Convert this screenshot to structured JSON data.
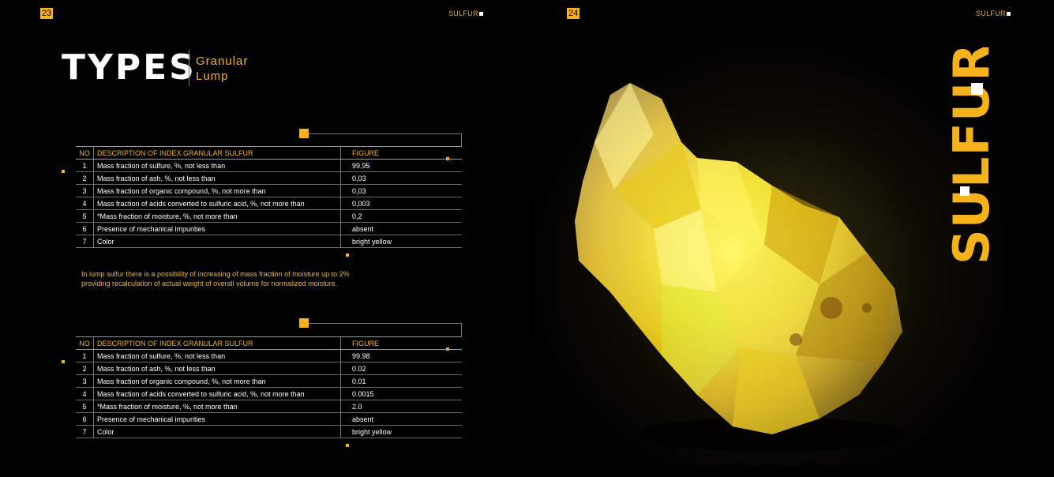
{
  "left_page": {
    "page_number": "23",
    "running_head": "SULFUR",
    "title": "TYPES",
    "subtypes": [
      "Granular",
      "Lump"
    ],
    "table1": {
      "headers": [
        "NO",
        "DESCRIPTION OF INDEX GRANULAR SULFUR",
        "FIGURE"
      ],
      "rows": [
        [
          "1",
          "Mass fraction of sulfure, %, not less than",
          "99,95"
        ],
        [
          "2",
          "Mass fraction of ash, %, not less than",
          "0,03"
        ],
        [
          "3",
          "Mass fraction of organic compound, %, not more than",
          "0,03"
        ],
        [
          "4",
          "Mass fraction of acids converted to sulfuric acid, %, not more than",
          "0,003"
        ],
        [
          "5",
          "*Mass fraction of moisture, %, not more than",
          "0,2"
        ],
        [
          "6",
          "Presence of mechanical impurities",
          "absent"
        ],
        [
          "7",
          "Color",
          "bright yellow"
        ]
      ]
    },
    "note_lines": [
      "In lump sulfur there is a possibility of increasing of mass fraction of moisture up to 2%",
      "providing recalculation of actual weight of overall volume for normalized moisture."
    ],
    "table2": {
      "headers": [
        "NO",
        "DESCRIPTION OF INDEX GRANULAR SULFUR",
        "FIGURE"
      ],
      "rows": [
        [
          "1",
          "Mass fraction of sulfure, %, not less than",
          "99.98"
        ],
        [
          "2",
          "Mass fraction of ash, %, not less than",
          "0.02"
        ],
        [
          "3",
          "Mass fraction of organic compound, %, not more than",
          "0.01"
        ],
        [
          "4",
          "Mass fraction of acids converted to sulfuric acid, %, not more than",
          "0.0015"
        ],
        [
          "5",
          "*Mass fraction of moisture, %, not more than",
          "2.0"
        ],
        [
          "6",
          "Presence of mechanical impurities",
          "absent"
        ],
        [
          "7",
          "Color",
          "bright yellow"
        ]
      ]
    }
  },
  "right_page": {
    "page_number": "24",
    "running_head": "SULFUR",
    "brand_word": "SULFUR"
  },
  "colors": {
    "accent": "#f6b21a",
    "background": "#000000",
    "text": "#ffffff"
  }
}
